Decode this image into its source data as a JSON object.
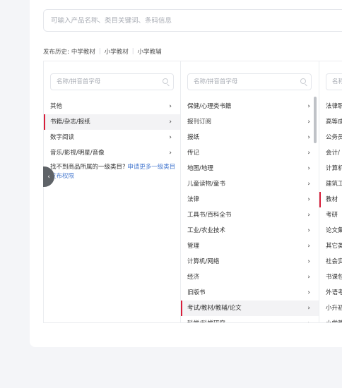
{
  "search": {
    "placeholder": "可输入产品名称、类目关键词、条码信息"
  },
  "history": {
    "label": "发布历史:",
    "items": [
      "中学教材",
      "小学教材",
      "小学教辅"
    ]
  },
  "columns": {
    "placeholder": "名称/拼音首字母",
    "col1": {
      "items": [
        {
          "label": "其他",
          "active": false
        },
        {
          "label": "书籍/杂志/报纸",
          "active": true
        },
        {
          "label": "数字阅读",
          "active": false
        },
        {
          "label": "音乐/影视/明星/音像",
          "active": false
        }
      ],
      "hint_text": "找不到商品所属的一级类目?",
      "hint_link": "申请更多一级类目发布权限"
    },
    "col2": {
      "items": [
        {
          "label": "保健/心理类书籍",
          "active": false
        },
        {
          "label": "报刊订阅",
          "active": false
        },
        {
          "label": "报纸",
          "active": false
        },
        {
          "label": "传记",
          "active": false
        },
        {
          "label": "地图/地理",
          "active": false
        },
        {
          "label": "儿童读物/童书",
          "active": false
        },
        {
          "label": "法律",
          "active": false
        },
        {
          "label": "工具书/百科全书",
          "active": false
        },
        {
          "label": "工业/农业技术",
          "active": false
        },
        {
          "label": "管理",
          "active": false
        },
        {
          "label": "计算机/网络",
          "active": false
        },
        {
          "label": "经济",
          "active": false
        },
        {
          "label": "旧版书",
          "active": false
        },
        {
          "label": "考试/教材/教辅/论文",
          "active": true
        },
        {
          "label": "科学/科学研究",
          "active": false
        }
      ]
    },
    "col3": {
      "items": [
        {
          "label": "法律职",
          "active": false
        },
        {
          "label": "高等成",
          "active": false
        },
        {
          "label": "公务员",
          "active": false
        },
        {
          "label": "会计/",
          "active": false
        },
        {
          "label": "计算机",
          "active": false
        },
        {
          "label": "建筑工",
          "active": false
        },
        {
          "label": "教材",
          "active": true
        },
        {
          "label": "考研",
          "active": false
        },
        {
          "label": "论文集",
          "active": false
        },
        {
          "label": "其它类",
          "active": false
        },
        {
          "label": "社会实",
          "active": false
        },
        {
          "label": "书课包",
          "active": false
        },
        {
          "label": "外语考",
          "active": false
        },
        {
          "label": "小升初",
          "active": false
        },
        {
          "label": "小学教",
          "active": false
        }
      ]
    },
    "arrow": "›"
  },
  "collapse_tab": {
    "glyph": "‹"
  },
  "colors": {
    "accent": "#d81e3a",
    "link": "#4a7bd0"
  }
}
